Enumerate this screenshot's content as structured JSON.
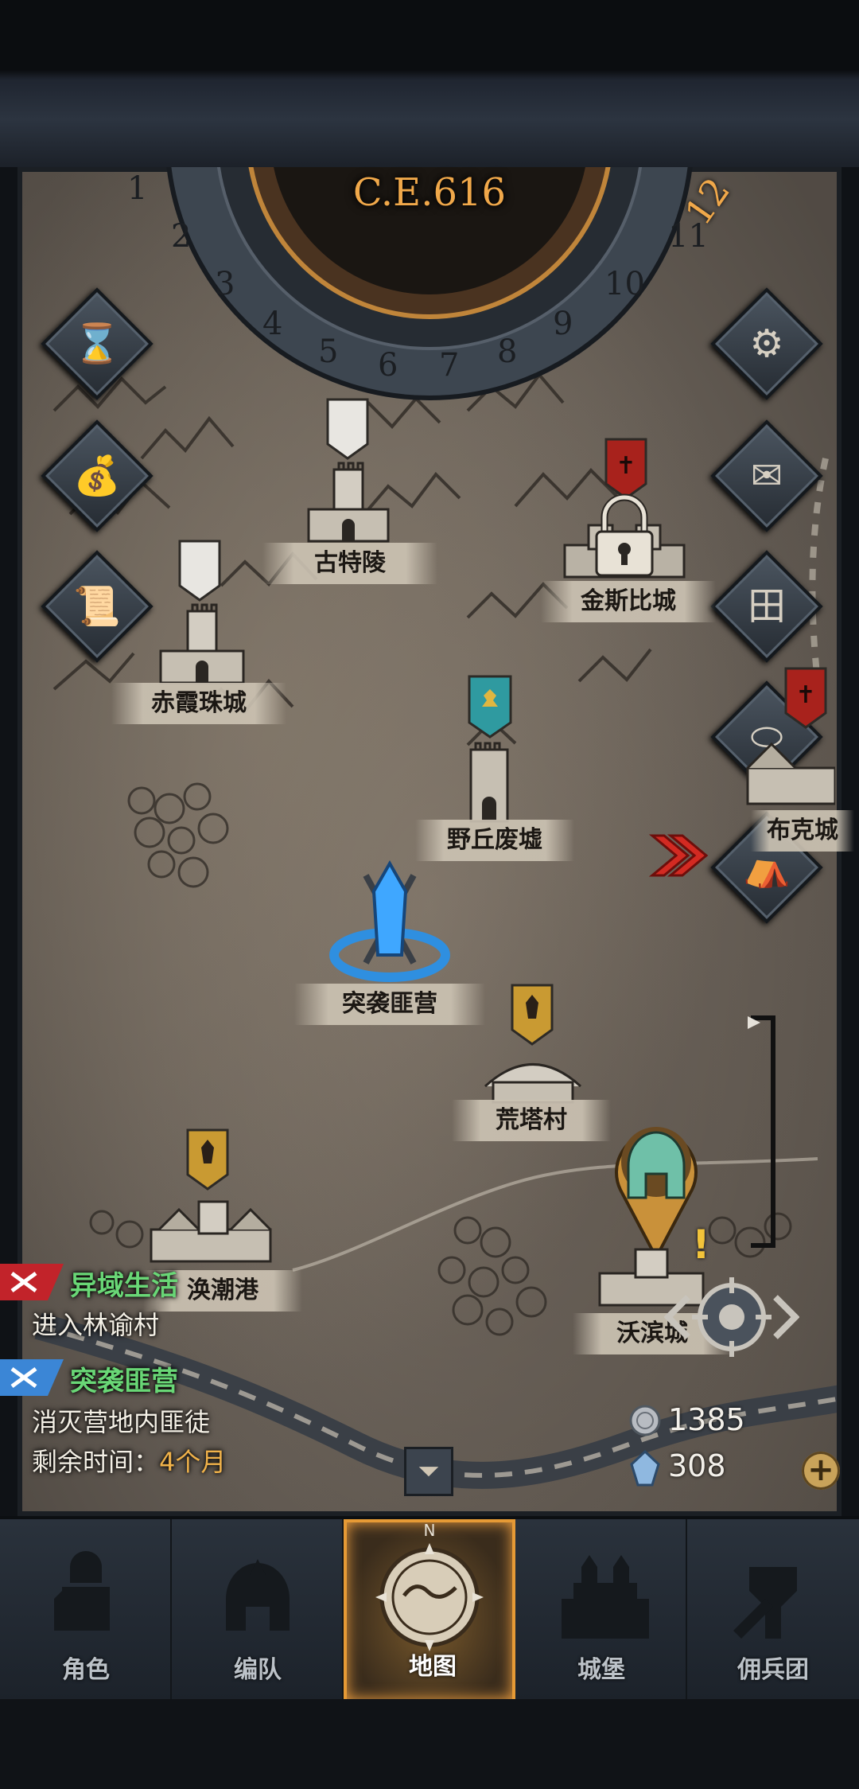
{
  "calendar": {
    "year": "C.E.616",
    "months": [
      "1",
      "2",
      "3",
      "4",
      "5",
      "6",
      "7",
      "8",
      "9",
      "10",
      "11"
    ],
    "current_month": "12"
  },
  "side_buttons": {
    "left": [
      "hourglass-icon",
      "coin-bag-icon",
      "scroll-icon"
    ],
    "right": [
      "gear-icon",
      "mail-icon",
      "window-icon",
      "coin-icon",
      "tavern-icon"
    ]
  },
  "towns": [
    {
      "name": "古特陵",
      "banner": "white"
    },
    {
      "name": "金斯比城",
      "banner": "red",
      "locked": true
    },
    {
      "name": "赤霞珠城",
      "banner": "white"
    },
    {
      "name": "野丘废墟",
      "banner": "teal"
    },
    {
      "name": "布克城",
      "banner": "red"
    },
    {
      "name": "突袭匪营",
      "marker": "sword-portal"
    },
    {
      "name": "荒塔村",
      "banner": "gold"
    },
    {
      "name": "涣潮港",
      "banner": "gold"
    },
    {
      "name": "沃滨城",
      "marker": "player-helmet"
    }
  ],
  "quests": [
    {
      "title": "异域生活",
      "desc": "进入林谕村"
    },
    {
      "title": "突袭匪营",
      "desc": "消灭营地内匪徒",
      "time_label": "剩余时间：",
      "time_value": "4个月"
    }
  ],
  "resources": {
    "silver": "1385",
    "crystal": "308"
  },
  "nav": [
    {
      "label": "角色",
      "icon": "knight-icon"
    },
    {
      "label": "编队",
      "icon": "helmet-icon"
    },
    {
      "label": "地图",
      "icon": "compass-map-icon",
      "active": true,
      "compass_letter": "N"
    },
    {
      "label": "城堡",
      "icon": "castle-icon"
    },
    {
      "label": "佣兵团",
      "icon": "mercenary-icon"
    }
  ],
  "colors": {
    "accent_orange": "#f0a84a",
    "quest_green": "#69d776",
    "map_parchment": "#7c7268"
  }
}
